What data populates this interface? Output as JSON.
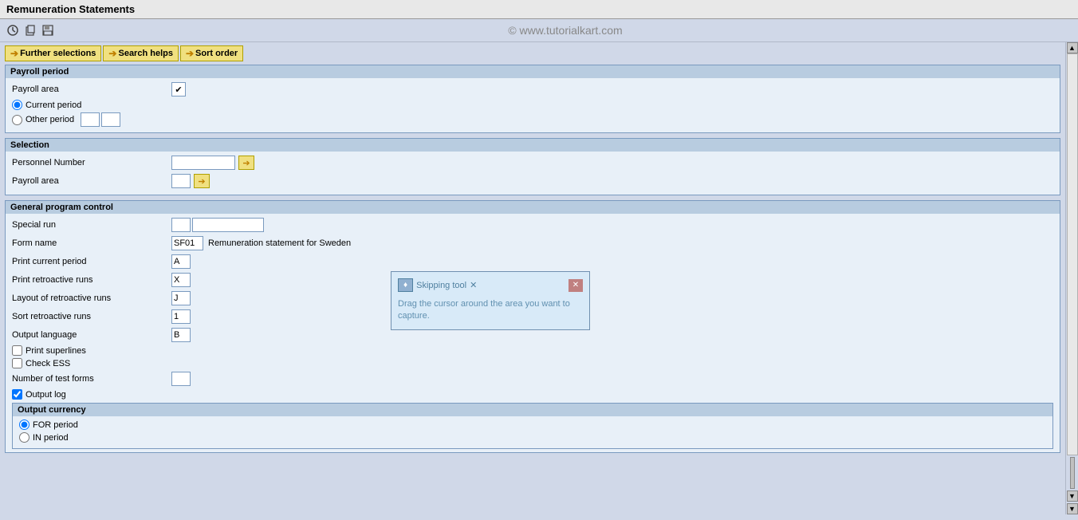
{
  "title": "Remuneration Statements",
  "toolbar": {
    "icons": [
      "clock-icon",
      "copy-icon",
      "save-icon"
    ],
    "watermark": "© www.tutorialkart.com"
  },
  "tabs": [
    {
      "label": "Further selections",
      "arrow": "➔"
    },
    {
      "label": "Search helps",
      "arrow": "➔"
    },
    {
      "label": "Sort order",
      "arrow": "➔"
    }
  ],
  "payroll_period": {
    "section_title": "Payroll period",
    "payroll_area_label": "Payroll area",
    "payroll_area_value": "✔",
    "current_period_label": "Current period",
    "other_period_label": "Other period"
  },
  "selection": {
    "section_title": "Selection",
    "personnel_number_label": "Personnel Number",
    "personnel_number_value": "",
    "payroll_area_label": "Payroll area",
    "payroll_area_value": ""
  },
  "general_program_control": {
    "section_title": "General program control",
    "special_run_label": "Special run",
    "special_run_val1": "",
    "special_run_val2": "",
    "form_name_label": "Form name",
    "form_name_value": "SF01",
    "form_name_description": "Remuneration statement for Sweden",
    "print_current_period_label": "Print current period",
    "print_current_period_value": "A",
    "print_retroactive_runs_label": "Print retroactive runs",
    "print_retroactive_runs_value": "X",
    "layout_retroactive_runs_label": "Layout of retroactive runs",
    "layout_retroactive_runs_value": "J",
    "sort_retroactive_runs_label": "Sort retroactive runs",
    "sort_retroactive_runs_value": "1",
    "output_language_label": "Output language",
    "output_language_value": "B",
    "print_superlines_label": "Print superlines",
    "print_superlines_checked": false,
    "check_ess_label": "Check ESS",
    "check_ess_checked": false,
    "number_test_forms_label": "Number of test forms",
    "number_test_forms_value": "",
    "output_log_label": "Output log",
    "output_log_checked": true
  },
  "output_currency": {
    "section_title": "Output currency",
    "for_period_label": "FOR period",
    "in_period_label": "IN period",
    "for_period_checked": true,
    "in_period_checked": false
  },
  "popup": {
    "step_label": "♦ Skipping tool ✕",
    "close_label": "✕",
    "text": "Drag the cursor around the area you want to capture."
  }
}
